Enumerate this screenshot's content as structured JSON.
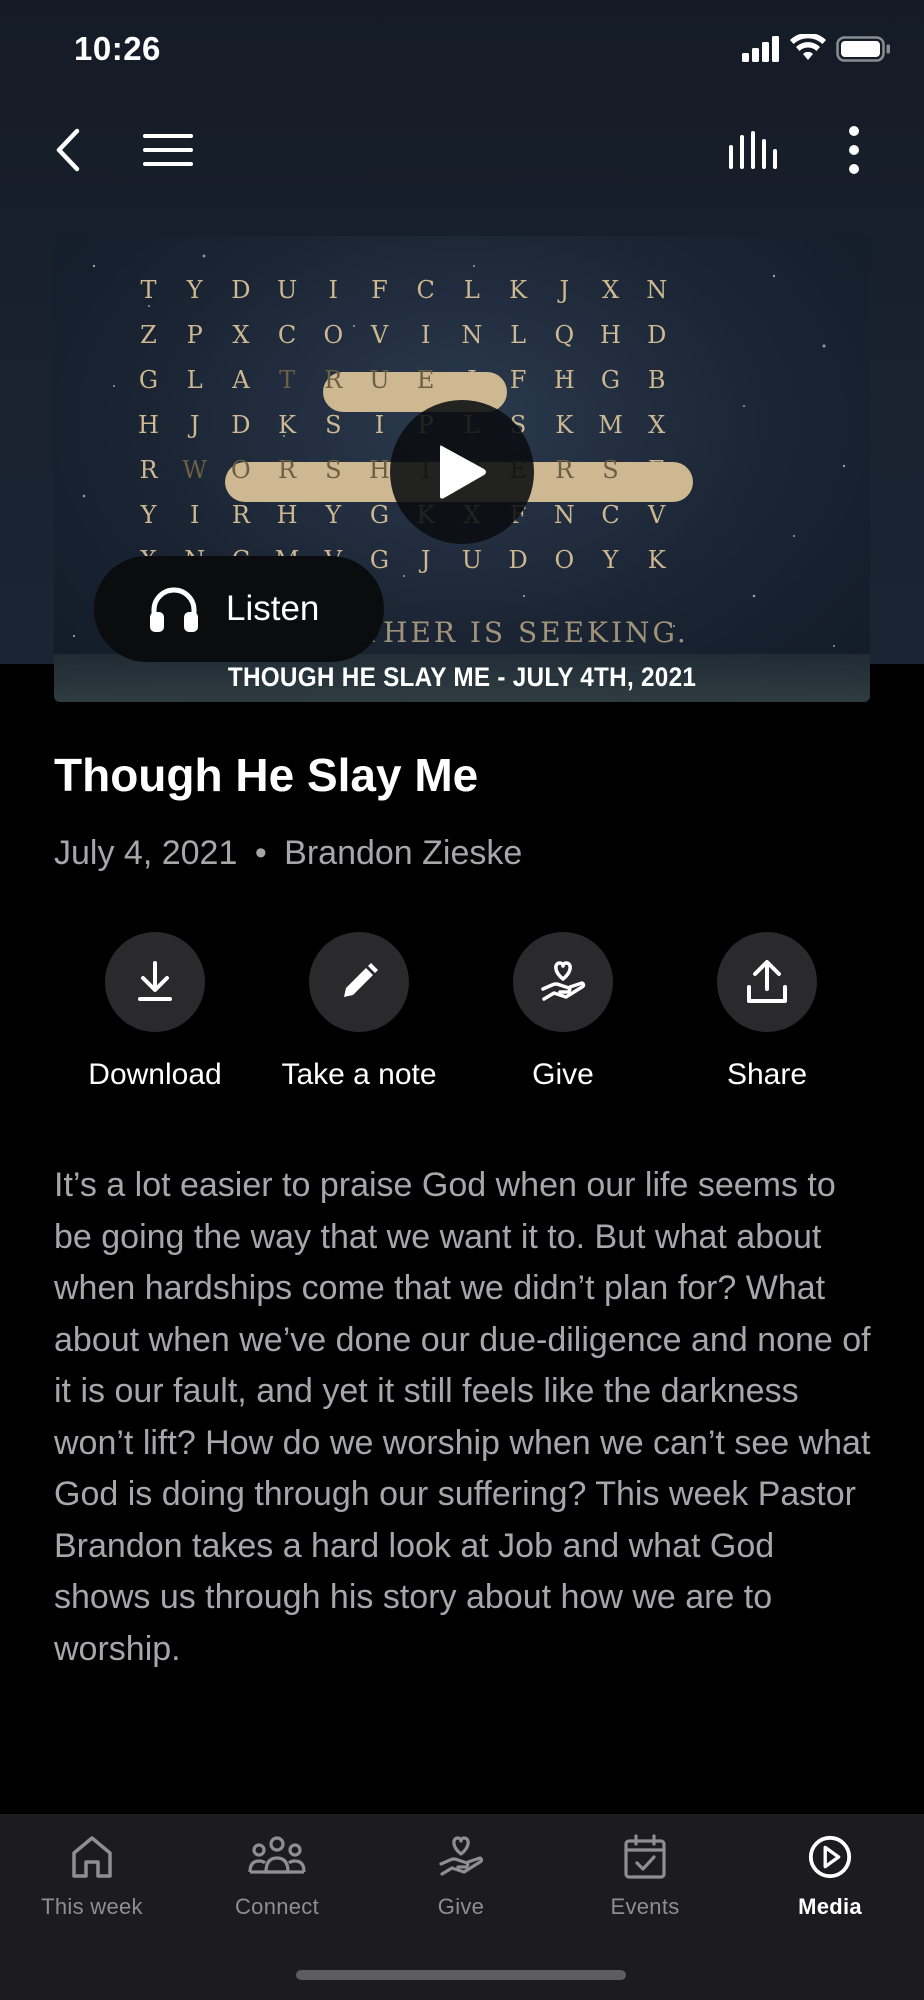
{
  "status_bar": {
    "time": "10:26"
  },
  "hero": {
    "letter_rows": [
      [
        "T",
        "Y",
        "D",
        "U",
        "I",
        "F",
        "C",
        "L",
        "K",
        "J",
        "X",
        "N"
      ],
      [
        "Z",
        "P",
        "X",
        "C",
        "O",
        "V",
        "I",
        "N",
        "L",
        "Q",
        "H",
        "D"
      ],
      [
        "G",
        "L",
        "A",
        "T",
        "R",
        "U",
        "E",
        "J",
        "F",
        "H",
        "G",
        "B"
      ],
      [
        "H",
        "J",
        "D",
        "K",
        "S",
        "I",
        "P",
        "L",
        "S",
        "K",
        "M",
        "X"
      ],
      [
        "R",
        "W",
        "O",
        "R",
        "S",
        "H",
        "I",
        "P",
        "E",
        "R",
        "S",
        "E"
      ],
      [
        "Y",
        "I",
        "R",
        "H",
        "Y",
        "G",
        "K",
        "X",
        "F",
        "N",
        "C",
        "V"
      ],
      [
        "X",
        "N",
        "C",
        "M",
        "V",
        "G",
        "J",
        "U",
        "D",
        "O",
        "Y",
        "K"
      ]
    ],
    "tagline": "THE FATHER IS SEEKING.",
    "caption": "THOUGH HE SLAY ME - JULY 4TH, 2021",
    "play_icon": "play-icon",
    "listen_label": "Listen",
    "listen_icon": "headphones-icon"
  },
  "sermon": {
    "title": "Though He Slay Me",
    "date": "July 4, 2021",
    "separator": "•",
    "speaker": "Brandon Zieske",
    "description": "It’s a lot easier to praise God when our life seems to be going the way that we want it to. But what about when hardships come that we didn’t plan for? What about when we’ve done our due-diligence and none of it is our fault, and yet it still feels like the darkness won’t lift? How do we worship when we can’t see what God is doing through our suffering? This week Pastor Brandon takes a hard look at Job and what God shows us through his story about how we are to worship."
  },
  "actions": [
    {
      "label": "Download",
      "icon": "download-icon"
    },
    {
      "label": "Take a note",
      "icon": "pencil-icon"
    },
    {
      "label": "Give",
      "icon": "give-hand-heart-icon"
    },
    {
      "label": "Share",
      "icon": "share-icon"
    }
  ],
  "tabs": [
    {
      "label": "This week",
      "icon": "home-icon"
    },
    {
      "label": "Connect",
      "icon": "group-icon"
    },
    {
      "label": "Give",
      "icon": "give-hand-heart-icon"
    },
    {
      "label": "Events",
      "icon": "calendar-icon"
    },
    {
      "label": "Media",
      "icon": "play-circle-icon",
      "active": true
    }
  ],
  "colors": {
    "background": "#000000",
    "tab_bar": "#1c1c1e",
    "muted_text": "#a7a7ab",
    "puzzle_gold": "#cdb891"
  }
}
